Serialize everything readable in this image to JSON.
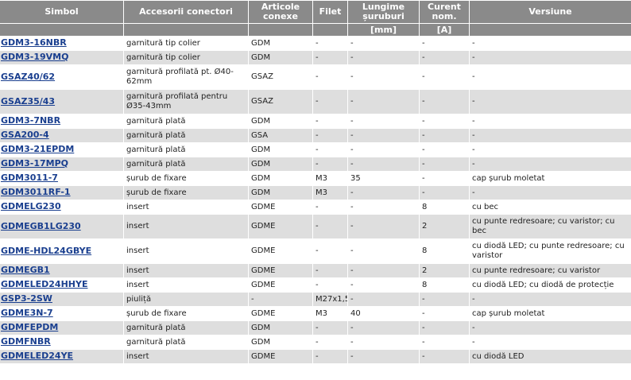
{
  "headers": [
    "Simbol",
    "Accesorii conectori",
    "Articole conexe",
    "Filet",
    "Lungime șuruburi",
    "Curent nom.",
    "Versiune"
  ],
  "units": [
    "",
    "",
    "",
    "",
    "[mm]",
    "[A]",
    ""
  ],
  "rows": [
    {
      "symbol": "GDM3-16NBR",
      "accessory": "garnitură tip colier",
      "related": "GDM",
      "thread": "-",
      "length": "-",
      "current": "-",
      "version": "-"
    },
    {
      "symbol": "GDM3-19VMQ",
      "accessory": "garnitură tip colier",
      "related": "GDM",
      "thread": "-",
      "length": "-",
      "current": "-",
      "version": "-"
    },
    {
      "symbol": "GSAZ40/62",
      "accessory": "garnitură profilată pt. Ø40-62mm",
      "related": "GSAZ",
      "thread": "-",
      "length": "-",
      "current": "-",
      "version": "-"
    },
    {
      "symbol": "GSAZ35/43",
      "accessory": "garnitură profilată pentru Ø35-43mm",
      "related": "GSAZ",
      "thread": "-",
      "length": "-",
      "current": "-",
      "version": "-"
    },
    {
      "symbol": "GDM3-7NBR",
      "accessory": "garnitură plată",
      "related": "GDM",
      "thread": "-",
      "length": "-",
      "current": "-",
      "version": "-"
    },
    {
      "symbol": "GSA200-4",
      "accessory": "garnitură plată",
      "related": "GSA",
      "thread": "-",
      "length": "-",
      "current": "-",
      "version": "-"
    },
    {
      "symbol": "GDM3-21EPDM",
      "accessory": "garnitură plată",
      "related": "GDM",
      "thread": "-",
      "length": "-",
      "current": "-",
      "version": "-"
    },
    {
      "symbol": "GDM3-17MPQ",
      "accessory": "garnitură plată",
      "related": "GDM",
      "thread": "-",
      "length": "-",
      "current": "-",
      "version": "-"
    },
    {
      "symbol": "GDM3011-7",
      "accessory": "șurub de fixare",
      "related": "GDM",
      "thread": "M3",
      "length": "35",
      "current": "-",
      "version": "cap șurub moletat"
    },
    {
      "symbol": "GDM3011RF-1",
      "accessory": "șurub de fixare",
      "related": "GDM",
      "thread": "M3",
      "length": "-",
      "current": "-",
      "version": "-"
    },
    {
      "symbol": "GDMELG230",
      "accessory": "insert",
      "related": "GDME",
      "thread": "-",
      "length": "-",
      "current": "8",
      "version": "cu bec"
    },
    {
      "symbol": "GDMEGB1LG230",
      "accessory": "insert",
      "related": "GDME",
      "thread": "-",
      "length": "-",
      "current": "2",
      "version": "cu punte redresoare; cu varistor; cu bec"
    },
    {
      "symbol": "GDME-HDL24GBYE",
      "accessory": "insert",
      "related": "GDME",
      "thread": "-",
      "length": "-",
      "current": "8",
      "version": "cu diodă LED; cu punte redresoare; cu varistor"
    },
    {
      "symbol": "GDMEGB1",
      "accessory": "insert",
      "related": "GDME",
      "thread": "-",
      "length": "-",
      "current": "2",
      "version": "cu punte redresoare; cu varistor"
    },
    {
      "symbol": "GDMELED24HHYE",
      "accessory": "insert",
      "related": "GDME",
      "thread": "-",
      "length": "-",
      "current": "8",
      "version": "cu diodă LED; cu diodă de protecție"
    },
    {
      "symbol": "GSP3-2SW",
      "accessory": "piuliță",
      "related": "-",
      "thread": "M27x1,5",
      "length": "-",
      "current": "-",
      "version": "-"
    },
    {
      "symbol": "GDME3N-7",
      "accessory": "șurub de fixare",
      "related": "GDME",
      "thread": "M3",
      "length": "40",
      "current": "-",
      "version": "cap șurub moletat"
    },
    {
      "symbol": "GDMFEPDM",
      "accessory": "garnitură plată",
      "related": "GDM",
      "thread": "-",
      "length": "-",
      "current": "-",
      "version": "-"
    },
    {
      "symbol": "GDMFNBR",
      "accessory": "garnitură plată",
      "related": "GDM",
      "thread": "-",
      "length": "-",
      "current": "-",
      "version": "-"
    },
    {
      "symbol": "GDMELED24YE",
      "accessory": "insert",
      "related": "GDME",
      "thread": "-",
      "length": "-",
      "current": "-",
      "version": "cu diodă LED"
    }
  ]
}
